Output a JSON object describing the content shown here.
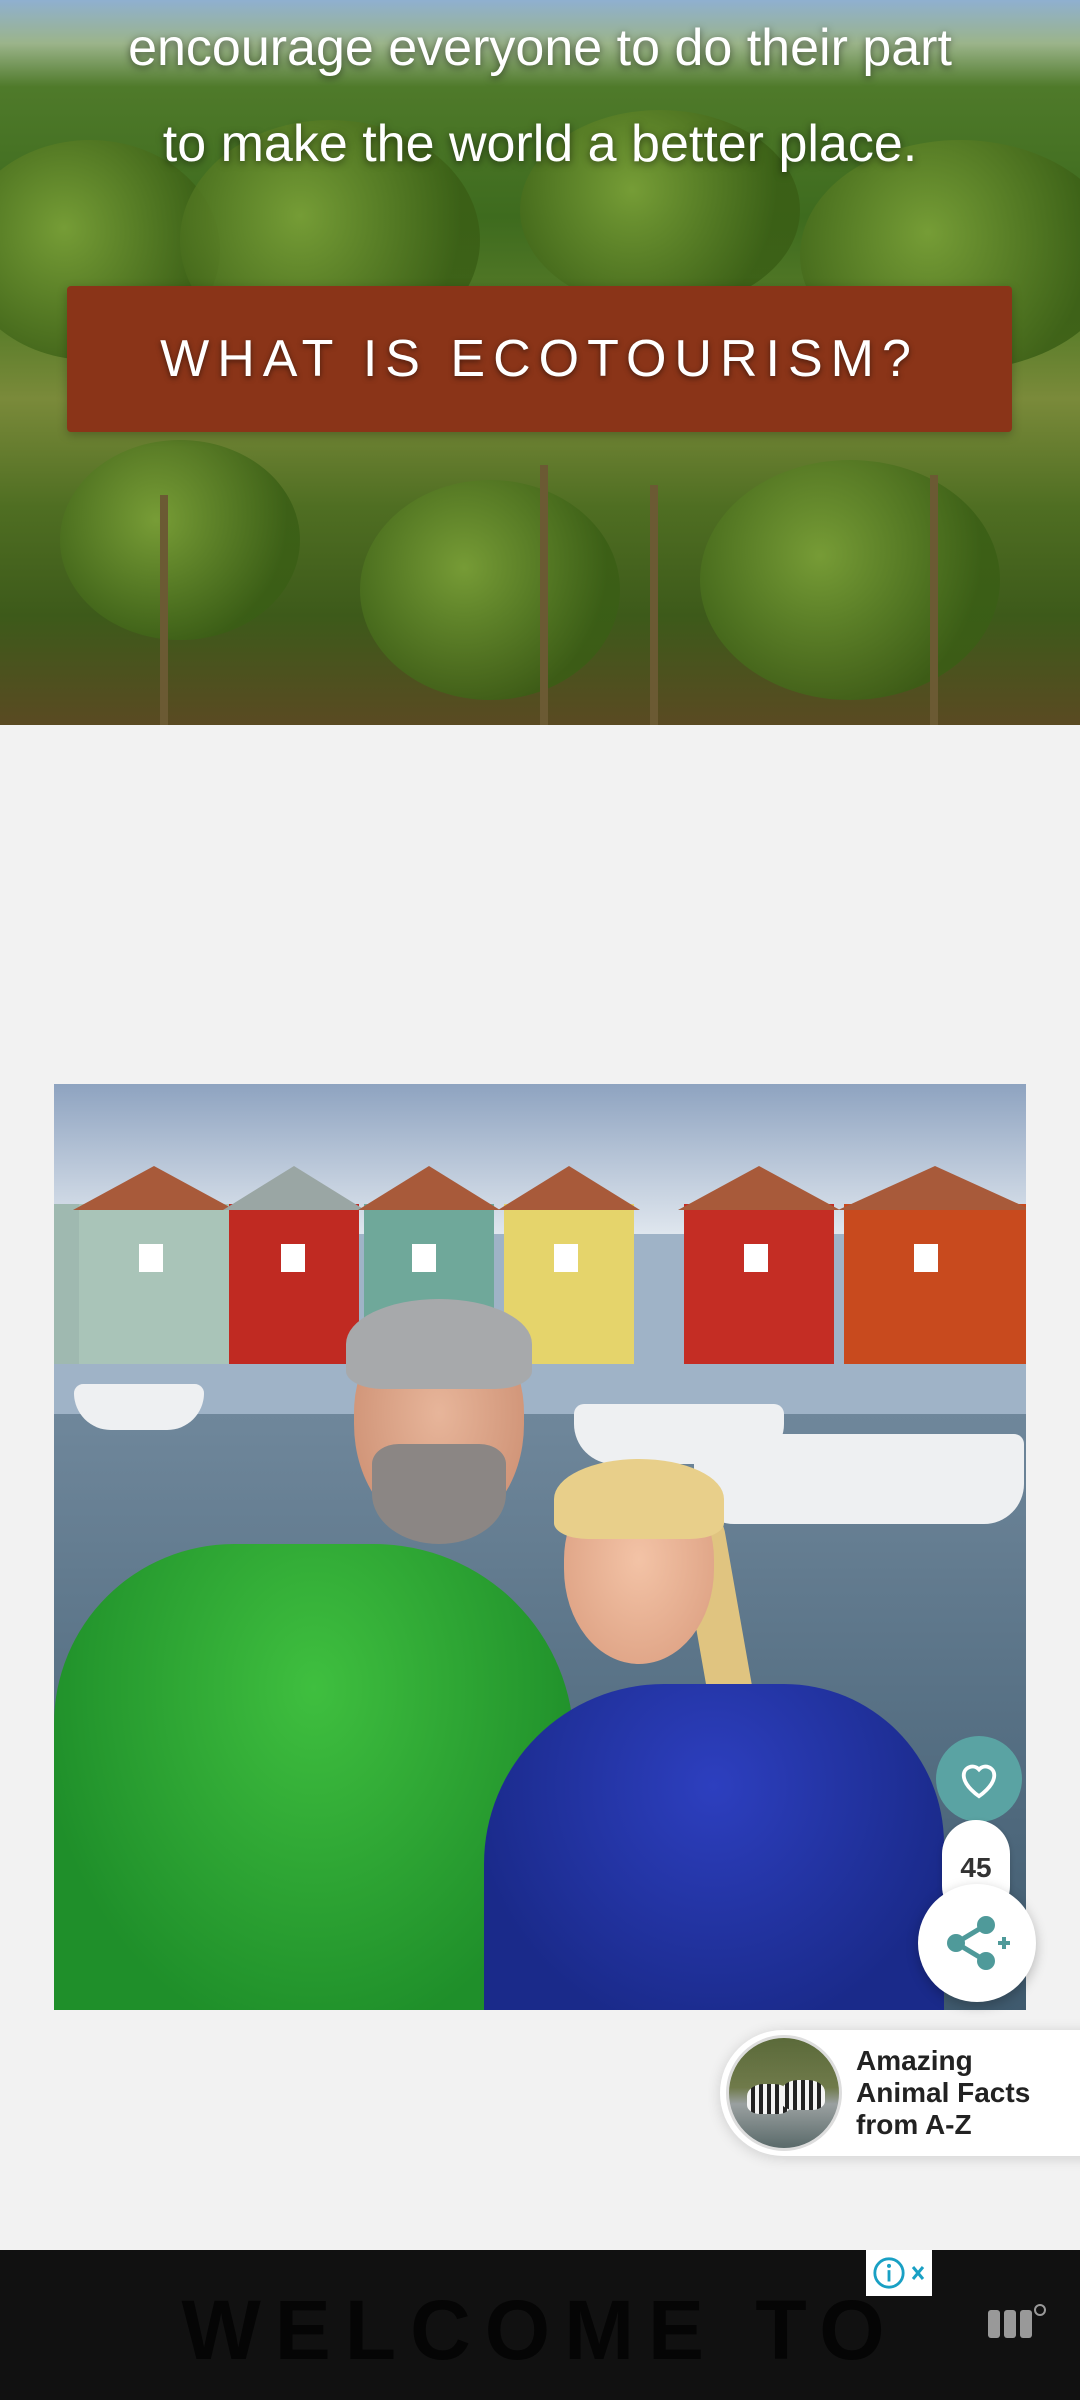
{
  "hero": {
    "line1": "encourage everyone to do their part",
    "line2": "to make the world a better place.",
    "cta_label": "WHAT IS ECOTOURISM?"
  },
  "photo": {
    "alt": "couple in front of colorful boathouses"
  },
  "actions": {
    "like_icon": "heart-icon",
    "share_icon": "share-icon",
    "share_count": "45"
  },
  "promo": {
    "title_line1": "Amazing",
    "title_line2": "Animal Facts",
    "title_line3": "from A-Z"
  },
  "footer": {
    "title": "WELCOME TO"
  },
  "colors": {
    "cta": "#8a3418",
    "like_bg": "#5aa3a3",
    "share_icon": "#4f9a9a",
    "ad_info": "#19a0c4"
  }
}
